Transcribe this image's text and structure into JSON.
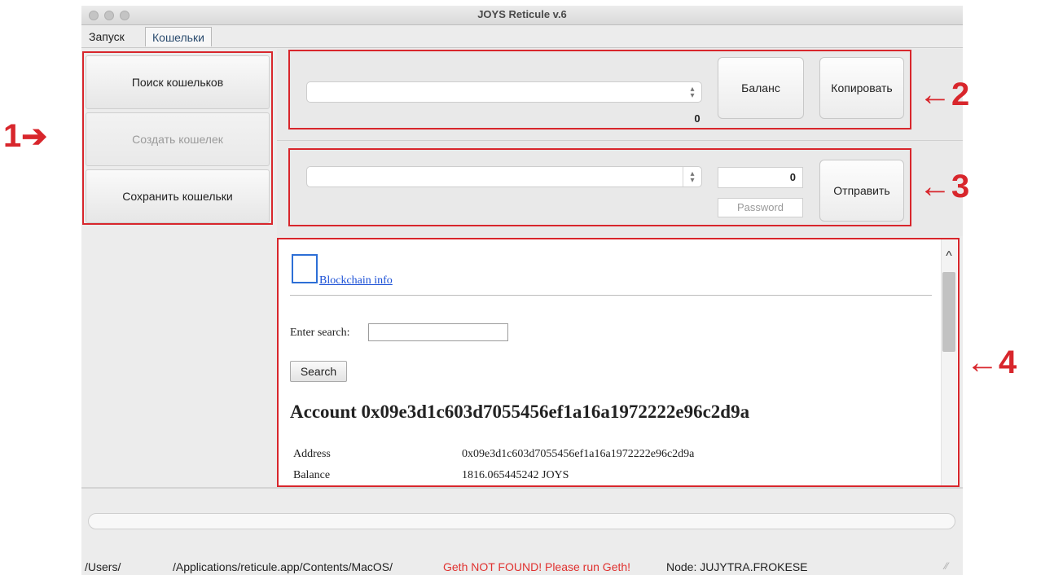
{
  "window": {
    "title": "JOYS Reticule v.6"
  },
  "tabs": [
    {
      "label": "Запуск"
    },
    {
      "label": "Кошельки"
    }
  ],
  "sidebar": {
    "buttons": [
      {
        "label": "Поиск кошельков",
        "enabled": true
      },
      {
        "label": "Создать кошелек",
        "enabled": false
      },
      {
        "label": "Сохранить кошельки",
        "enabled": true
      }
    ]
  },
  "balance_panel": {
    "wallet_select_value": "",
    "balance_value": "0",
    "balance_button": "Баланс",
    "copy_button": "Копировать"
  },
  "send_panel": {
    "recipient_select_value": "",
    "amount_value": "0",
    "password_placeholder": "Password",
    "send_button": "Отправить"
  },
  "browser": {
    "link_text": "Blockchain info",
    "search_label": "Enter search:",
    "search_value": "",
    "search_button": "Search",
    "heading": "Account 0x09e3d1c603d7055456ef1a16a1972222e96c2d9a",
    "rows": [
      {
        "key": "Address",
        "value": "0x09e3d1c603d7055456ef1a16a1972222e96c2d9a"
      },
      {
        "key": "Balance",
        "value": "1816.065445242 JOYS"
      }
    ]
  },
  "statusbar": {
    "user_path": "/Users/",
    "app_path": "/Applications/reticule.app/Contents/MacOS/",
    "geth_status": "Geth NOT FOUND! Please run Geth!",
    "node": "Node: JUJYTRA.FROKESE"
  },
  "annotations": [
    {
      "label": "1",
      "arrow": "➔"
    },
    {
      "label": "2",
      "arrow": "←"
    },
    {
      "label": "3",
      "arrow": "←"
    },
    {
      "label": "4",
      "arrow": "←"
    }
  ],
  "colors": {
    "annotation_red": "#d8262c",
    "status_error": "#e0312f",
    "link": "#1a4fd6"
  }
}
